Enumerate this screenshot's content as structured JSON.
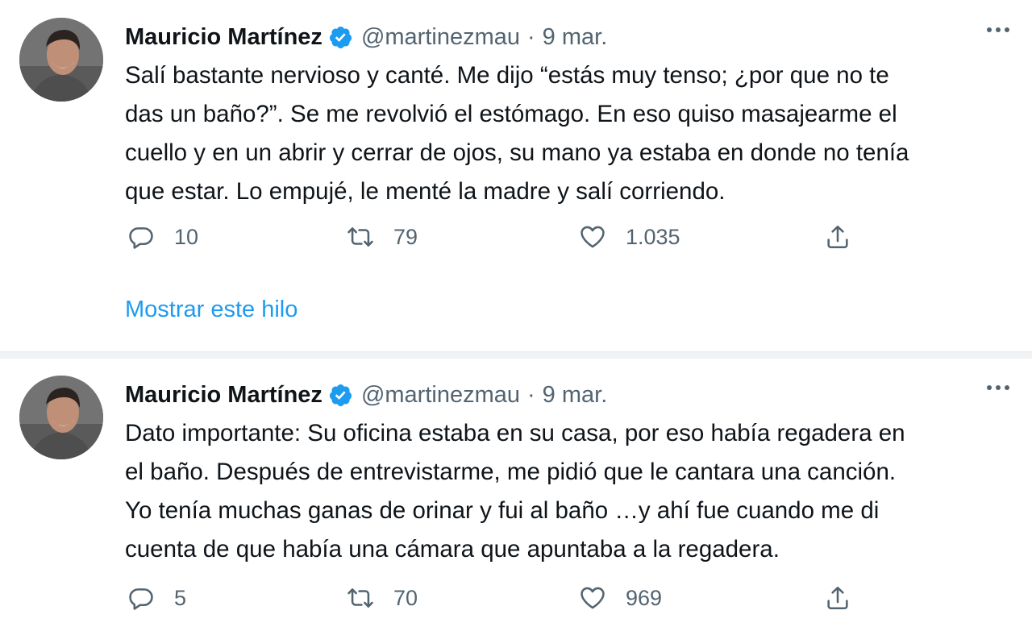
{
  "tweets": [
    {
      "author_name": "Mauricio Martínez",
      "handle": "@martinezmau",
      "separator": "·",
      "date": "9 mar.",
      "lines": [
        "Salí bastante nervioso y canté. Me dijo “estás muy tenso; ¿por que no te",
        "das un baño?”. Se me revolvió el estómago. En eso quiso masajearme el",
        "cuello y en un abrir y cerrar de ojos, su mano ya estaba en donde no tenía",
        "que estar. Lo empujé, le menté la madre y salí corriendo."
      ],
      "replies": "10",
      "retweets": "79",
      "likes": "1.035",
      "show_thread": "Mostrar este hilo"
    },
    {
      "author_name": "Mauricio Martínez",
      "handle": "@martinezmau",
      "separator": "·",
      "date": "9 mar.",
      "lines": [
        "Dato importante: Su oficina estaba en su casa, por eso había regadera en",
        "el baño. Después de entrevistarme, me pidió que le cantara una canción.",
        "Yo tenía muchas ganas de orinar y fui al baño …y ahí fue cuando me di",
        "cuenta de que había una cámara que apuntaba a la regadera."
      ],
      "replies": "5",
      "retweets": "70",
      "likes": "969"
    }
  ],
  "icons": {
    "verified": "verified-badge-icon",
    "more": "more-options-icon",
    "reply": "reply-icon",
    "retweet": "retweet-icon",
    "like": "like-heart-icon",
    "share": "share-icon"
  },
  "colors": {
    "text": "#0f1419",
    "secondary": "#536471",
    "link": "#1d9bf0",
    "verified": "#1d9bf0",
    "divider": "#f0f2f4"
  }
}
